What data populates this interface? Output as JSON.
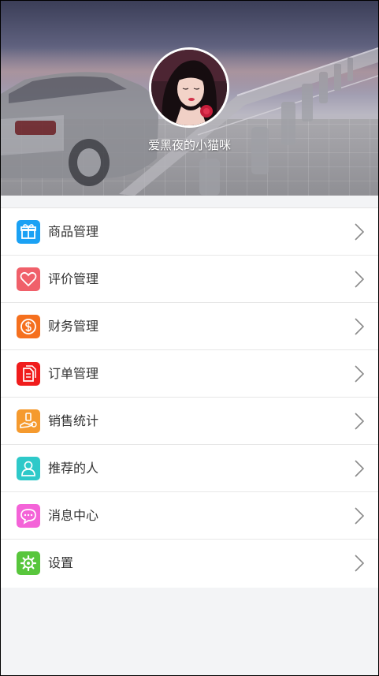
{
  "profile": {
    "username": "爱黑夜的小猫咪"
  },
  "menu": {
    "items": [
      {
        "label": "商品管理",
        "icon": "gift-icon",
        "color": "#1aa1f4"
      },
      {
        "label": "评价管理",
        "icon": "heart-icon",
        "color": "#f0606a"
      },
      {
        "label": "财务管理",
        "icon": "dollar-coin-icon",
        "color": "#f5701e"
      },
      {
        "label": "订单管理",
        "icon": "documents-icon",
        "color": "#f01c1c"
      },
      {
        "label": "销售统计",
        "icon": "sales-hand-icon",
        "color": "#f59a2e"
      },
      {
        "label": "推荐的人",
        "icon": "person-icon",
        "color": "#2ec9c9"
      },
      {
        "label": "消息中心",
        "icon": "chat-bubble-icon",
        "color": "#f463d8"
      },
      {
        "label": "设置",
        "icon": "gear-icon",
        "color": "#58c63c"
      }
    ]
  }
}
